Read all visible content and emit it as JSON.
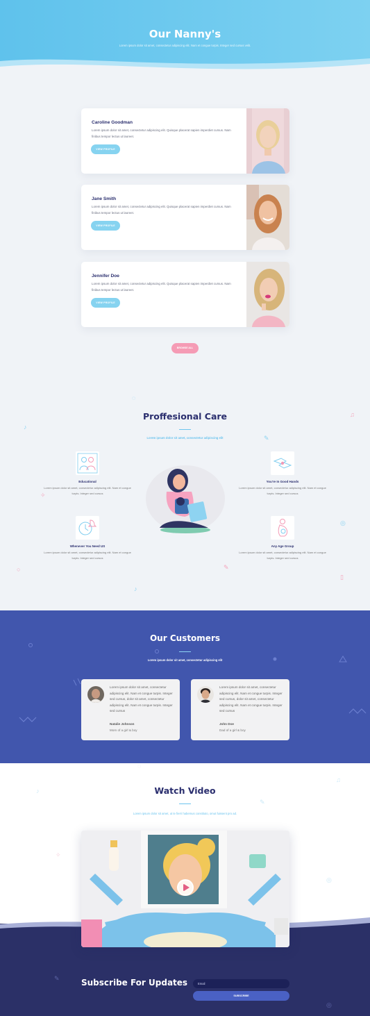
{
  "hero": {
    "title": "Our Nanny's",
    "subtitle": "Lorem ipsum dolor sit amet, consectetur adipiscing elit. Nam et congue turpis. Integer sed cursus velit."
  },
  "nannies": [
    {
      "name": "Caroline Goodman",
      "description": "Lorem ipsum dolor sit amet, consectetur adipiscing elit. Quisque placerat sapien imperdiet cursus. Nam finibus tempor lectus ut laoreet.",
      "button": "VIEW PROFILE"
    },
    {
      "name": "Jane Smith",
      "description": "Lorem ipsum dolor sit amet, consectetur adipiscing elit. Quisque placerat sapien imperdiet cursus. Nam finibus tempor lectus ut laoreet.",
      "button": "VIEW PROFILE"
    },
    {
      "name": "Jennifer Doe",
      "description": "Lorem ipsum dolor sit amet, consectetur adipiscing elit. Quisque placerat sapien imperdiet cursus. Nam finibus tempor lectus ut laoreet.",
      "button": "VIEW PROFILE"
    }
  ],
  "browse_button": "BROWSE ALL",
  "care": {
    "title": "Proffesional Care",
    "subtitle": "Lorem ipsum dolor sit amet, consectetur adipiscing elit",
    "features": [
      {
        "title": "Educational",
        "description": "Lorem ipsum dolor sit amet, consectetur adipiscing elit. Nam et congue turpis. Integer sed cursus",
        "icon": "people-icon"
      },
      {
        "title": "You're In Good Hands",
        "description": "Lorem ipsum dolor sit amet, consectetur adipiscing elit. Nam et congue turpis. Integer sed cursus",
        "icon": "hands-icon"
      },
      {
        "title": "Whenever You Need US",
        "description": "Lorem ipsum dolor sit amet, consectetur adipiscing elit. Nam et congue turpis. Integer sed cursus",
        "icon": "clock-bell-icon"
      },
      {
        "title": "Any Age Group",
        "description": "Lorem ipsum dolor sit amet, consectetur adipiscing elit. Nam et congue turpis. Integer sed cursus",
        "icon": "pregnant-icon"
      }
    ]
  },
  "customers": {
    "title": "Our Customers",
    "subtitle": "Lorem ipsum dolor sit amet, consectetur adipiscing elit",
    "testimonials": [
      {
        "quote": "Lorem ipsum dolor sit amet, consectetur adipiscing elit. Nam et congue turpis. Integer sed cursus, dolor sit amet, consectetur adipiscing elit. Nam et congue turpis. Integer sed cursus",
        "name": "Natalie Johnson",
        "role": "Mom of a girl & boy"
      },
      {
        "quote": "Lorem ipsum dolor sit amet, consectetur adipiscing elit. Nam et congue turpis. Integer sed cursus, dolor sit amet, consectetur adipiscing elit. Nam et congue turpis. Integer sed cursus",
        "name": "John Doe",
        "role": "Dad of a girl & boy"
      }
    ]
  },
  "video": {
    "title": "Watch Video",
    "subtitle": "Lorem ipsum dolor sit amet, ut te fierri habemus constituto, omut fuissent pro ad."
  },
  "subscribe": {
    "title": "Subscribe For Updates",
    "email_placeholder": "Email",
    "button": "SUBSCRIBE"
  },
  "colors": {
    "hero": "#6ccaef",
    "navy": "#2a2e6e",
    "accent_blue": "#86d3f0",
    "accent_pink": "#f59bb5",
    "customers_bg": "#4156ad",
    "footer_bg": "#2b3067"
  }
}
